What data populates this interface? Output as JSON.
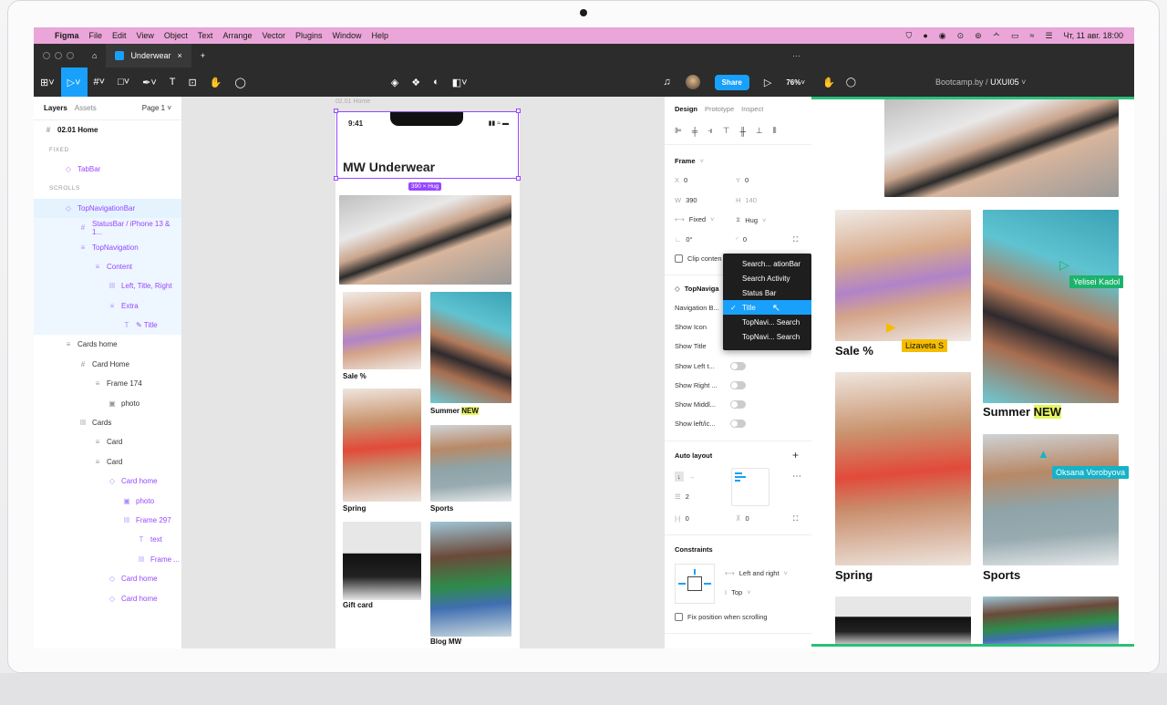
{
  "menubar": {
    "app": "Figma",
    "items": [
      "File",
      "Edit",
      "View",
      "Object",
      "Text",
      "Arrange",
      "Vector",
      "Plugins",
      "Window",
      "Help"
    ],
    "clock": "Чт, 11 авг.  18:00"
  },
  "tabbar": {
    "file_tab": "Underwear",
    "more": "···"
  },
  "toolbar": {
    "share": "Share",
    "zoom": "76%"
  },
  "layers_panel": {
    "tab_layers": "Layers",
    "tab_assets": "Assets",
    "page": "Page 1",
    "items": [
      {
        "label": "02.01 Home",
        "icon": "#"
      },
      {
        "label": "FIXED",
        "icon": ""
      },
      {
        "label": "TabBar",
        "icon": "◇"
      },
      {
        "label": "SCROLLS",
        "icon": ""
      },
      {
        "label": "TopNavigationBar",
        "icon": "◇"
      },
      {
        "label": "StatusBar / iPhone 13 & 1...",
        "icon": "#"
      },
      {
        "label": "TopNavigation",
        "icon": "≡"
      },
      {
        "label": "Content",
        "icon": "≡"
      },
      {
        "label": "Left, Title, Right",
        "icon": "ǀǀǀ"
      },
      {
        "label": "Extra",
        "icon": "≡"
      },
      {
        "label": "✎ Title",
        "icon": "T"
      },
      {
        "label": "Cards home",
        "icon": "≡"
      },
      {
        "label": "Card Home",
        "icon": "#"
      },
      {
        "label": "Frame 174",
        "icon": "≡"
      },
      {
        "label": "photo",
        "icon": "▣"
      },
      {
        "label": "Cards",
        "icon": "ǀǀǀ"
      },
      {
        "label": "Card",
        "icon": "≡"
      },
      {
        "label": "Card",
        "icon": "≡"
      },
      {
        "label": "Card home",
        "icon": "◇"
      },
      {
        "label": "photo",
        "icon": "▣"
      },
      {
        "label": "Frame 297",
        "icon": "ǀǀǀ"
      },
      {
        "label": "text",
        "icon": "T"
      },
      {
        "label": "Frame ...",
        "icon": "ǀǀǀ"
      },
      {
        "label": "Card home",
        "icon": "◇"
      },
      {
        "label": "Card home",
        "icon": "◇"
      }
    ]
  },
  "canvas": {
    "frame_label": "02.01 Home",
    "status_time": "9:41",
    "page_title": "MW Underwear",
    "hug_badge": "390 × Hug",
    "cards": [
      "Sale %",
      "Summer",
      "NEW",
      "Spring",
      "Sports",
      "Gift card",
      "Blog MW"
    ]
  },
  "design_panel": {
    "tabs": [
      "Design",
      "Prototype",
      "Inspect"
    ],
    "frame_title": "Frame",
    "x_label": "X",
    "x": "0",
    "y_label": "Y",
    "y": "0",
    "w_label": "W",
    "w": "390",
    "h_label": "H",
    "h": "140",
    "width_mode": "Fixed",
    "height_mode": "Hug",
    "rotation": "0°",
    "radius": "0",
    "clip": "Clip conten",
    "component": "TopNaviga",
    "props": [
      "Navigation B...",
      "Show Icon",
      "Show Title",
      "Show Left t...",
      "Show Right ...",
      "Show Middl...",
      "Show left/ic..."
    ],
    "auto_layout": "Auto layout",
    "spacing": "2",
    "padding_h": "0",
    "padding_v": "0",
    "constraints": "Constraints",
    "constraint_h": "Left and right",
    "constraint_v": "Top",
    "fix_scroll": "Fix position when scrolling"
  },
  "dropdown": {
    "items": [
      "Search... ationBar",
      "Search Activity",
      "Status Bar",
      "Title",
      "TopNavi... Search",
      "TopNavi... Search"
    ],
    "selected": "Title"
  },
  "prototype_view": {
    "path": "Bootcamp.by",
    "sep": "/",
    "page": "UXUI05",
    "cursors": [
      {
        "name": "Yelisei Kadol",
        "color": "#1bb36d"
      },
      {
        "name": "Lizaveta S",
        "color": "#f5bd00"
      },
      {
        "name": "Oksana Vorobyova",
        "color": "#16b2c8"
      }
    ],
    "captions": [
      "Sale %",
      "Summer",
      "NEW",
      "Spring",
      "Sports"
    ]
  }
}
